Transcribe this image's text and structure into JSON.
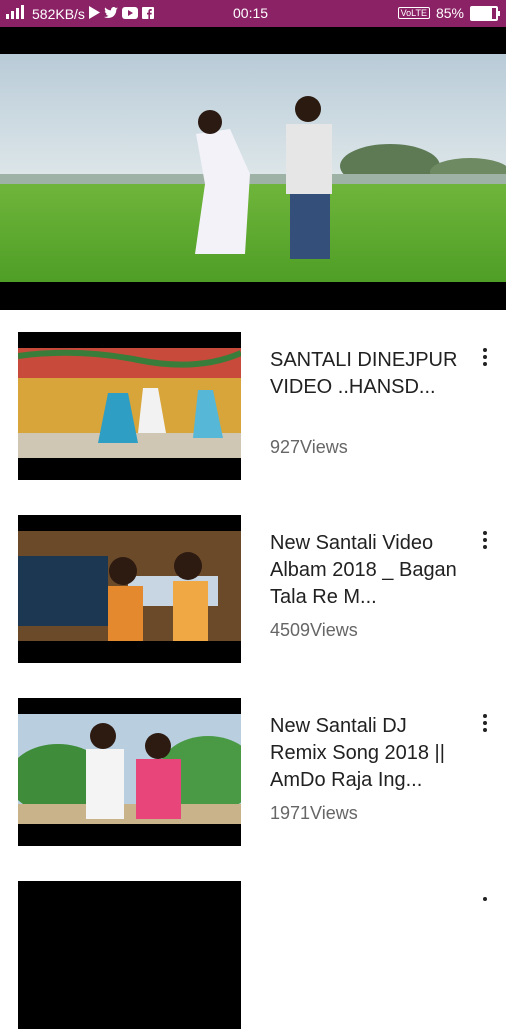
{
  "status_bar": {
    "network_speed": "582KB/s",
    "time": "00:15",
    "volte": "VoLTE",
    "battery_percent": "85%",
    "battery_level": 0.85
  },
  "videos": [
    {
      "title": "SANTALI DINEJPUR VIDEO ..HANSD...",
      "views": "927Views"
    },
    {
      "title": "New Santali Video Albam 2018 _ Bagan Tala Re M...",
      "views": "4509Views"
    },
    {
      "title": "New Santali DJ Remix Song 2018 || AmDo Raja Ing...",
      "views": "1971Views"
    }
  ]
}
